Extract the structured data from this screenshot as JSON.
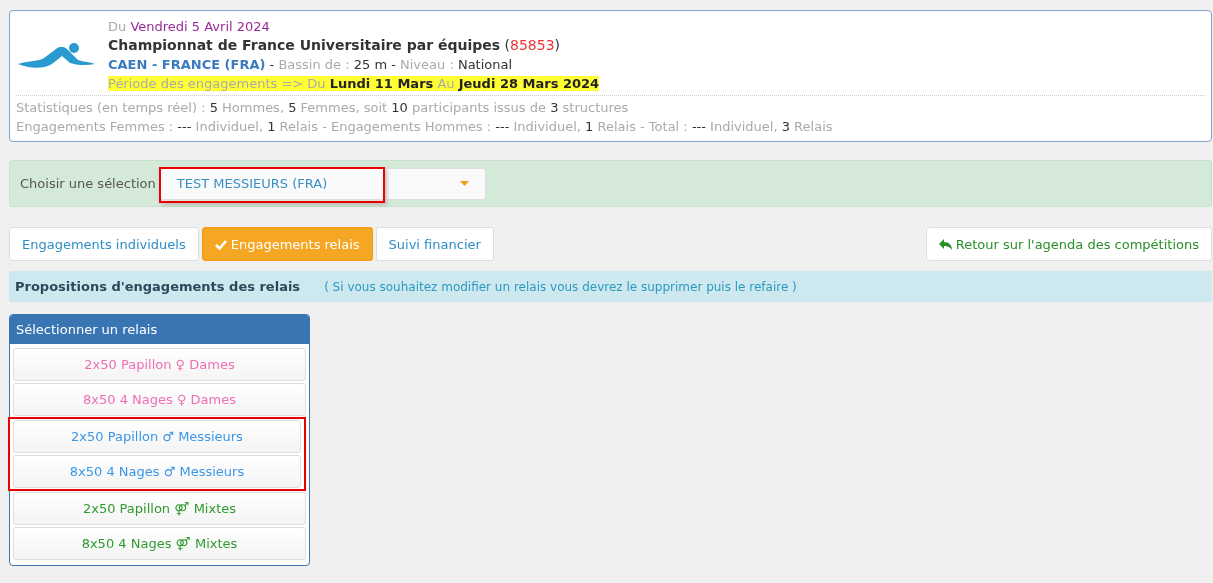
{
  "event": {
    "lines": [
      [
        {
          "kind": "muted",
          "text": "Du "
        },
        {
          "kind": "date",
          "text": "Vendredi 5 Avril 2024"
        }
      ],
      [
        {
          "kind": "title",
          "text": "Championnat de France Universitaire par équipes"
        },
        {
          "kind": "plain",
          "text": " ("
        },
        {
          "kind": "code",
          "text": "85853"
        },
        {
          "kind": "plain",
          "text": ")"
        }
      ],
      [
        {
          "kind": "place",
          "text": "CAEN - FRANCE (FRA)"
        },
        {
          "kind": "plain",
          "text": " - "
        },
        {
          "kind": "muted",
          "text": "Bassin de : "
        },
        {
          "kind": "plain",
          "text": "25 m"
        },
        {
          "kind": "plain",
          "text": " - "
        },
        {
          "kind": "muted",
          "text": "Niveau : "
        },
        {
          "kind": "plain",
          "text": "National"
        }
      ],
      [
        {
          "kind": "muted",
          "text": "Période des engagements => Du "
        },
        {
          "kind": "bold",
          "text": "Lundi 11 Mars"
        },
        {
          "kind": "muted",
          "text": " Au "
        },
        {
          "kind": "bold",
          "text": "Jeudi 28 Mars 2024"
        }
      ]
    ],
    "period_line_highlighted": true,
    "stats": [
      [
        {
          "kind": "muted",
          "text": "Statistiques (en temps réel) : "
        },
        {
          "kind": "plain",
          "text": "5"
        },
        {
          "kind": "muted",
          "text": " Hommes, "
        },
        {
          "kind": "plain",
          "text": "5"
        },
        {
          "kind": "muted",
          "text": " Femmes, soit "
        },
        {
          "kind": "plain",
          "text": "10"
        },
        {
          "kind": "muted",
          "text": " participants issus de "
        },
        {
          "kind": "plain",
          "text": "3"
        },
        {
          "kind": "muted",
          "text": " structures"
        }
      ],
      [
        {
          "kind": "muted",
          "text": "Engagements Femmes : "
        },
        {
          "kind": "plain",
          "text": "---"
        },
        {
          "kind": "muted",
          "text": " Individuel, "
        },
        {
          "kind": "plain",
          "text": "1"
        },
        {
          "kind": "muted",
          "text": " Relais - Engagements Hommes : "
        },
        {
          "kind": "plain",
          "text": "---"
        },
        {
          "kind": "muted",
          "text": " Individuel, "
        },
        {
          "kind": "plain",
          "text": "1"
        },
        {
          "kind": "muted",
          "text": " Relais - Total : "
        },
        {
          "kind": "plain",
          "text": "---"
        },
        {
          "kind": "muted",
          "text": " Individuel, "
        },
        {
          "kind": "plain",
          "text": "3"
        },
        {
          "kind": "muted",
          "text": " Relais"
        }
      ]
    ]
  },
  "selection": {
    "label": "Choisir une sélection",
    "value": "TEST MESSIEURS (FRA)",
    "highlighted": true
  },
  "tabs": [
    {
      "label": "Engagements individuels",
      "selected": false
    },
    {
      "label": "Engagements relais",
      "selected": true
    },
    {
      "label": "Suivi financier",
      "selected": false
    }
  ],
  "back_button": "Retour sur l'agenda des compétitions",
  "info": {
    "title": "Propositions d'engagements des relais",
    "note": "( Si vous souhaitez modifier un relais vous devrez le supprimer puis le refaire )"
  },
  "relay_panel": {
    "title": "Sélectionner un relais",
    "items": [
      {
        "event": "2x50 Papillon",
        "symbol": "♀",
        "category": "Dames",
        "color": "#f06fb4",
        "highlighted": false
      },
      {
        "event": "8x50 4 Nages",
        "symbol": "♀",
        "category": "Dames",
        "color": "#f06fb4",
        "highlighted": false
      },
      {
        "event": "2x50 Papillon",
        "symbol": "♂",
        "category": "Messieurs",
        "color": "#3a96e6",
        "highlighted": true
      },
      {
        "event": "8x50 4 Nages",
        "symbol": "♂",
        "category": "Messieurs",
        "color": "#3a96e6",
        "highlighted": true
      },
      {
        "event": "2x50 Papillon",
        "symbol": "⚤",
        "category": "Mixtes",
        "color": "#2f9a2f",
        "highlighted": false
      },
      {
        "event": "8x50 4 Nages",
        "symbol": "⚤",
        "category": "Mixtes",
        "color": "#2f9a2f",
        "highlighted": false
      }
    ]
  }
}
